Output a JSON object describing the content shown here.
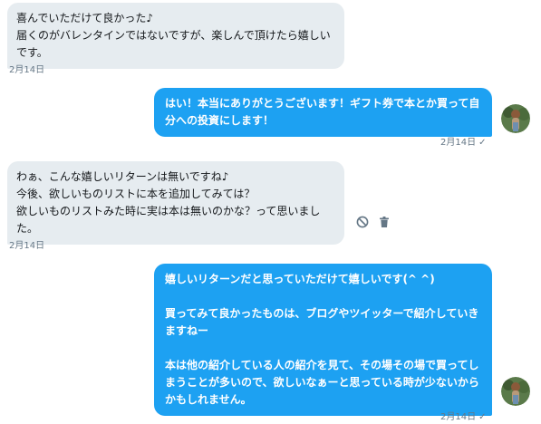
{
  "conversation": {
    "messages": [
      {
        "direction": "in",
        "text": "喜んでいただけて良かった♪\n届くのがバレンタインではないですが、楽しんで頂けたら嬉しいです。",
        "date": "2月14日"
      },
      {
        "direction": "out",
        "text": "はい！本当にありがとうございます！ギフト券で本とか買って自分への投資にします！",
        "date": "2月14日",
        "status": "✓"
      },
      {
        "direction": "in",
        "text": "わぁ、こんな嬉しいリターンは無いですね♪\n今後、欲しいものリストに本を追加してみては？\n欲しいものリストみた時に実は本は無いのかな？って思いました。",
        "date": "2月14日",
        "actions": [
          "block-icon",
          "delete-icon"
        ]
      },
      {
        "direction": "out",
        "text": "嬉しいリターンだと思っていただけて嬉しいです(^ ^)\n\n買ってみて良かったものは、ブログやツイッターで紹介していきますねー\n\n本は他の紹介している人の紹介を見て、その場その場で買ってしまうことが多いので、欲しいなぁーと思っている時が少ないからかもしれません。",
        "date": "2月14日",
        "status": "✓"
      }
    ]
  },
  "colors": {
    "incoming_bubble": "#e6ecf0",
    "outgoing_bubble": "#1da1f2",
    "meta_text": "#657786"
  }
}
